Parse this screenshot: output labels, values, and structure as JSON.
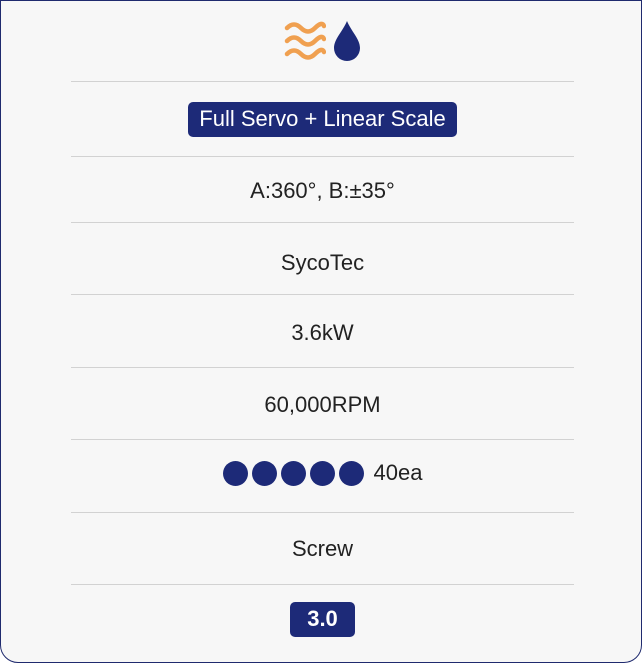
{
  "icons": {
    "coolant": {
      "name": "coolant-waves-icon",
      "color": "#f0a050"
    },
    "water": {
      "name": "water-drop-icon",
      "color": "#1d2a78"
    }
  },
  "control": {
    "label": "Full Servo + Linear Scale"
  },
  "axes": {
    "value": "A:360°, B:±35°"
  },
  "spindle_brand": {
    "value": "SycoTec"
  },
  "power": {
    "value": "3.6kW"
  },
  "speed": {
    "value": "60,000RPM"
  },
  "tool_changer": {
    "dots": 5,
    "value": "40ea"
  },
  "clamping": {
    "value": "Screw"
  },
  "rating": {
    "value": "3.0"
  },
  "colors": {
    "accent": "#1d2a78",
    "orange": "#f0a050",
    "divider": "#d2d2d2",
    "background": "#f7f7f7"
  }
}
